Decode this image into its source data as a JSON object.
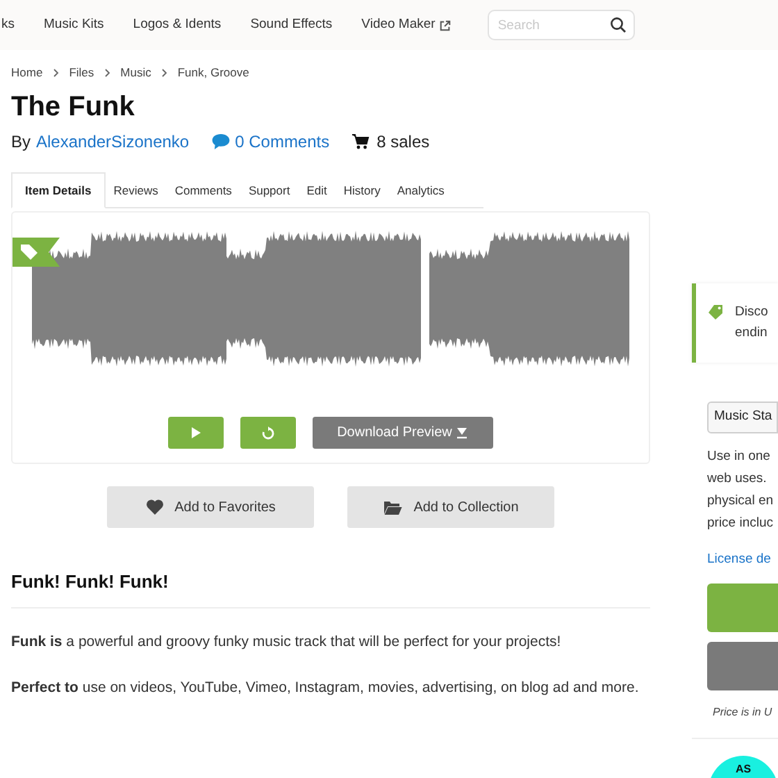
{
  "nav": {
    "items": [
      {
        "label": "ks",
        "external": false
      },
      {
        "label": "Music Kits",
        "external": false
      },
      {
        "label": "Logos & Idents",
        "external": false
      },
      {
        "label": "Sound Effects",
        "external": false
      },
      {
        "label": "Video Maker",
        "external": true
      }
    ],
    "search": {
      "placeholder": "Search"
    }
  },
  "breadcrumb": [
    "Home",
    "Files",
    "Music",
    "Funk, Groove"
  ],
  "title": "The Funk",
  "byline": {
    "prefix": "By",
    "author": "AlexanderSizonenko",
    "comments": "0 Comments",
    "sales": "8 sales"
  },
  "tabs": [
    {
      "label": "Item Details",
      "selected": true
    },
    {
      "label": "Reviews",
      "selected": false
    },
    {
      "label": "Comments",
      "selected": false
    },
    {
      "label": "Support",
      "selected": false
    },
    {
      "label": "Edit",
      "selected": false
    },
    {
      "label": "History",
      "selected": false
    },
    {
      "label": "Analytics",
      "selected": false
    }
  ],
  "player": {
    "download": "Download Preview"
  },
  "actions": [
    "Add to Favorites",
    "Add to Collection"
  ],
  "description": {
    "heading": "Funk! Funk! Funk!",
    "paragraphs": [
      "**Funk is** a powerful and groovy funky music track that will be perfect for your projects!",
      "**Perfect to** use on videos, YouTube, Vimeo, Instagram, movies, advertising, on blog ad and more."
    ]
  },
  "sidebar": {
    "discount": [
      "Disco",
      "endin"
    ],
    "license_select": "Music Sta",
    "license_text": [
      "Use in one",
      "web uses.",
      "physical en",
      "price incluc"
    ],
    "license_link": "License de",
    "price_note": "Price is in U",
    "author_badge": "AS"
  }
}
